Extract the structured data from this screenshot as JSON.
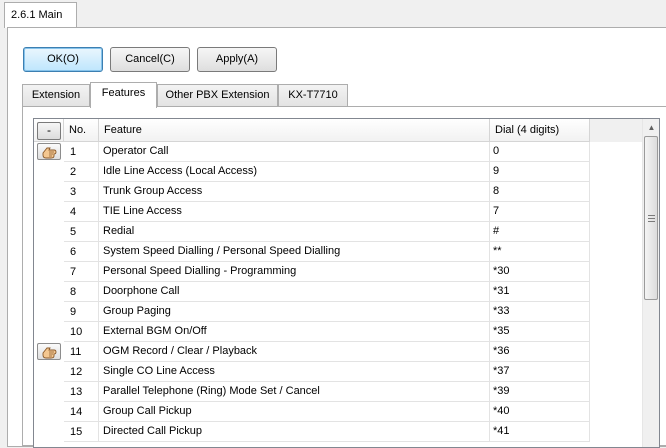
{
  "window": {
    "tab_label": "2.6.1 Main"
  },
  "buttons": {
    "ok": "OK(O)",
    "cancel": "Cancel(C)",
    "apply": "Apply(A)"
  },
  "tabs": [
    {
      "label": "Extension"
    },
    {
      "label": "Features",
      "active": true
    },
    {
      "label": "Other PBX Extension"
    },
    {
      "label": "KX-T7710"
    }
  ],
  "grid": {
    "collapse_button": "-",
    "columns": {
      "no": "No.",
      "feature": "Feature",
      "dial": "Dial (4 digits)"
    },
    "rows": [
      {
        "no": "1",
        "feature": "Operator Call",
        "dial": "0",
        "icon": "hand-icon"
      },
      {
        "no": "2",
        "feature": "Idle Line Access (Local Access)",
        "dial": "9"
      },
      {
        "no": "3",
        "feature": "Trunk Group Access",
        "dial": "8"
      },
      {
        "no": "4",
        "feature": "TIE Line Access",
        "dial": "7"
      },
      {
        "no": "5",
        "feature": "Redial",
        "dial": "#"
      },
      {
        "no": "6",
        "feature": "System Speed Dialling / Personal Speed Dialling",
        "dial": "**"
      },
      {
        "no": "7",
        "feature": "Personal Speed Dialling - Programming",
        "dial": "*30"
      },
      {
        "no": "8",
        "feature": "Doorphone Call",
        "dial": "*31"
      },
      {
        "no": "9",
        "feature": "Group Paging",
        "dial": "*33"
      },
      {
        "no": "10",
        "feature": "External BGM On/Off",
        "dial": "*35"
      },
      {
        "no": "11",
        "feature": "OGM Record / Clear / Playback",
        "dial": "*36",
        "icon": "hand-icon"
      },
      {
        "no": "12",
        "feature": "Single CO Line Access",
        "dial": "*37"
      },
      {
        "no": "13",
        "feature": "Parallel Telephone (Ring) Mode Set / Cancel",
        "dial": "*39"
      },
      {
        "no": "14",
        "feature": "Group Call Pickup",
        "dial": "*40"
      },
      {
        "no": "15",
        "feature": "Directed Call Pickup",
        "dial": "*41"
      }
    ]
  }
}
